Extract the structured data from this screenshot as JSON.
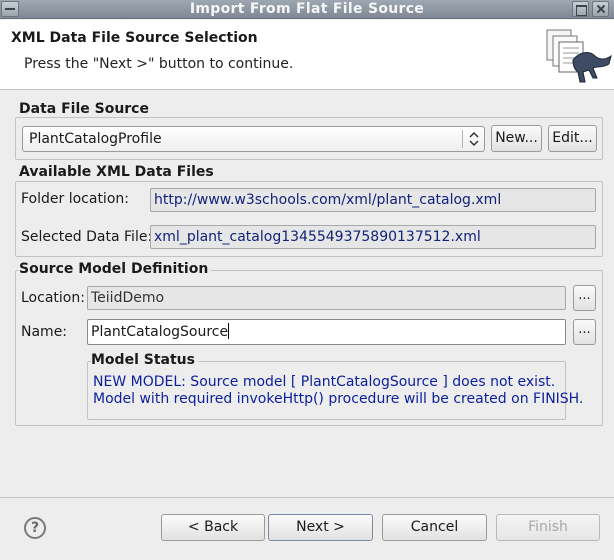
{
  "window": {
    "title": "Import From Flat File Source"
  },
  "header": {
    "title": "XML Data File Source Selection",
    "message": "Press the \"Next >\" button to continue."
  },
  "data_file_source": {
    "group_label": "Data File Source",
    "selected": "PlantCatalogProfile",
    "new_label": "New...",
    "edit_label": "Edit..."
  },
  "available_files": {
    "group_label": "Available XML Data Files",
    "folder_label": "Folder location:",
    "folder_value": "http://www.w3schools.com/xml/plant_catalog.xml",
    "selected_label": "Selected Data File:",
    "selected_value": "xml_plant_catalog1345549375890137512.xml"
  },
  "source_model": {
    "group_label": "Source Model Definition",
    "location_label": "Location:",
    "location_value": "TeiidDemo",
    "name_label": "Name:",
    "name_value": "PlantCatalogSource",
    "browse_label": "...",
    "status": {
      "label": "Model Status",
      "line1": "NEW MODEL: Source model [ PlantCatalogSource ] does not exist.",
      "line2": "Model with required invokeHttp() procedure will be created on FINISH."
    }
  },
  "footer": {
    "help_label": "?",
    "back_label": "< Back",
    "next_label": "Next >",
    "cancel_label": "Cancel",
    "finish_label": "Finish"
  }
}
